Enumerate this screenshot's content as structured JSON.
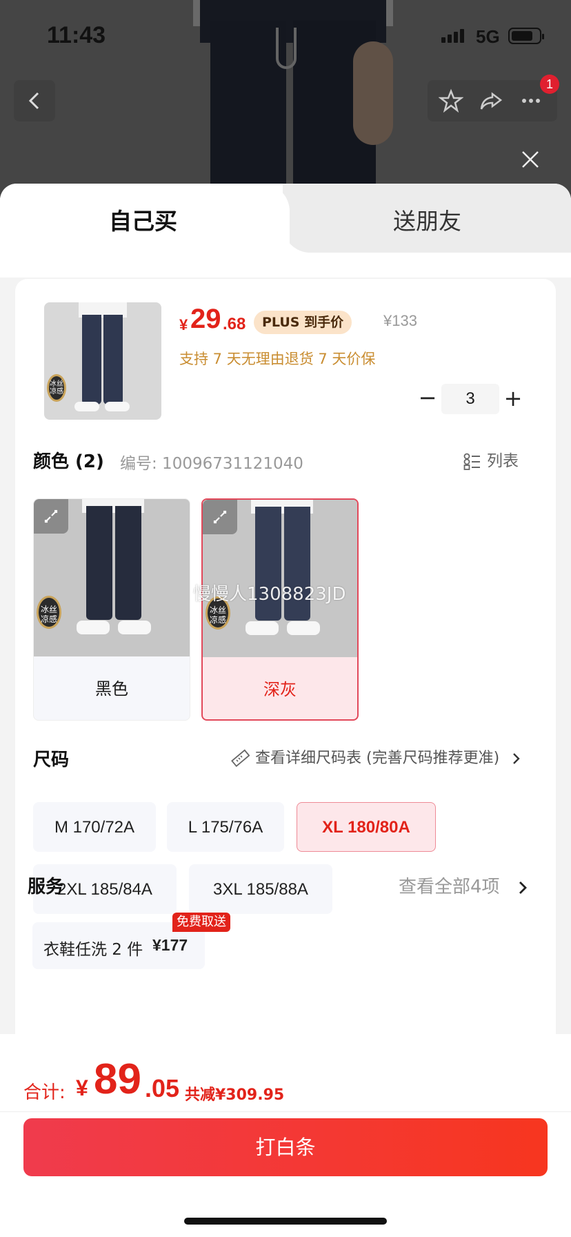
{
  "status_bar": {
    "time": "11:43",
    "network": "5G"
  },
  "nav": {
    "cart_badge": "1"
  },
  "tabs": {
    "self_buy": "自己买",
    "gift": "送朋友"
  },
  "product": {
    "thumb_badge": "冰丝\n凉感",
    "price_currency": "¥",
    "price_int": "29",
    "price_dec": ".68",
    "plus_label": "PLUS 到手价",
    "original_price": "¥133",
    "guarantees": "支持 7 天无理由退货    7 天价保",
    "quantity": "3",
    "minus": "−",
    "plus": "+"
  },
  "color_section": {
    "title": "颜色 (2)",
    "code_label": "编号: 10096731121040",
    "list_label": "列表",
    "options": [
      {
        "label": "黑色",
        "selected": false
      },
      {
        "label": "深灰",
        "selected": true
      }
    ],
    "watermark": "慢慢人1308823JD"
  },
  "size_section": {
    "title": "尺码",
    "chart_link": "查看详细尺码表 (完善尺码推荐更准)",
    "options": [
      {
        "label": "M 170/72A",
        "selected": false
      },
      {
        "label": "L 175/76A",
        "selected": false
      },
      {
        "label": "XL 180/80A",
        "selected": true
      },
      {
        "label": "2XL 185/84A",
        "selected": false
      },
      {
        "label": "3XL 185/88A",
        "selected": false
      }
    ]
  },
  "service_section": {
    "title": "服务",
    "view_all": "查看全部4项",
    "item_name": "衣鞋任洗 2 件",
    "item_price": "¥177",
    "item_tag": "免费取送"
  },
  "checkout": {
    "total_label": "合计:",
    "currency": "¥",
    "total_int": "89",
    "total_dec": ".05",
    "savings": "共减¥309.95",
    "button_label": "打白条"
  },
  "colors": {
    "accent": "#e2231a",
    "plus_bg": "#fbe3c9",
    "guarantee": "#c98d31"
  }
}
